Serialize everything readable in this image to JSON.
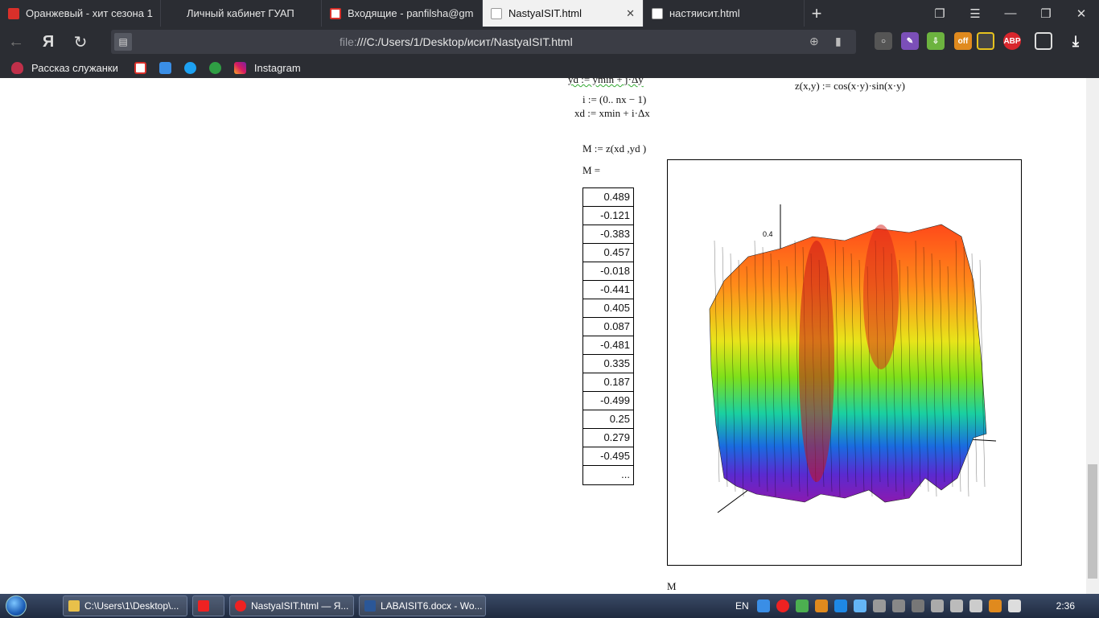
{
  "tabs": [
    {
      "title": "Оранжевый - хит сезона 1",
      "active": false,
      "favicon": "youtube-icon"
    },
    {
      "title": "Личный кабинет ГУАП",
      "active": false,
      "favicon": "none"
    },
    {
      "title": "Входящие - panfilsha@gm",
      "active": false,
      "favicon": "gmail-icon"
    },
    {
      "title": "NastyaISIT.html",
      "active": true,
      "favicon": "document-icon"
    },
    {
      "title": "настяисит.html",
      "active": false,
      "favicon": "document-icon"
    }
  ],
  "address_bar": {
    "scheme": "file:",
    "path": "///C:/Users/1/Desktop/исит/NastyaISIT.html"
  },
  "bookmarks": [
    {
      "label": "Рассказ служанки",
      "icon": "bookmark-icon"
    },
    {
      "label": "",
      "icon": "gmail-icon"
    },
    {
      "label": "",
      "icon": "chat-icon"
    },
    {
      "label": "",
      "icon": "twitter-icon"
    },
    {
      "label": "",
      "icon": "globe-icon"
    },
    {
      "label": "Instagram",
      "icon": "instagram-icon"
    }
  ],
  "extensions": {
    "abp_label": "ABP",
    "off_label": "off"
  },
  "math": {
    "line_yd": "yd  := ymin + j·Δy",
    "line_i": "i := (0.. nx − 1)",
    "line_xd": "xd  := xmin + i·Δx",
    "line_M": "M    := z(xd ,yd )",
    "line_Meq": "M    =",
    "line_z": "z(x,y) := cos(x·y)·sin(x·y)",
    "plot_caption": "M",
    "plot_tick": "0.4"
  },
  "matrix_values": [
    "0.489",
    "-0.121",
    "-0.383",
    "0.457",
    "-0.018",
    "-0.441",
    "0.405",
    "0.087",
    "-0.481",
    "0.335",
    "0.187",
    "-0.499",
    "0.25",
    "0.279",
    "-0.495",
    "..."
  ],
  "taskbar": {
    "tasks": [
      {
        "label": "C:\\Users\\1\\Desktop\\...",
        "icon": "folder-icon"
      },
      {
        "label": "",
        "icon": "yandex-icon"
      },
      {
        "label": "NastyaISIT.html — Я...",
        "icon": "yandex-browser-icon"
      },
      {
        "label": "LABAISIT6.docx - Wo...",
        "icon": "word-icon"
      }
    ],
    "lang": "EN",
    "clock": "2:36"
  }
}
